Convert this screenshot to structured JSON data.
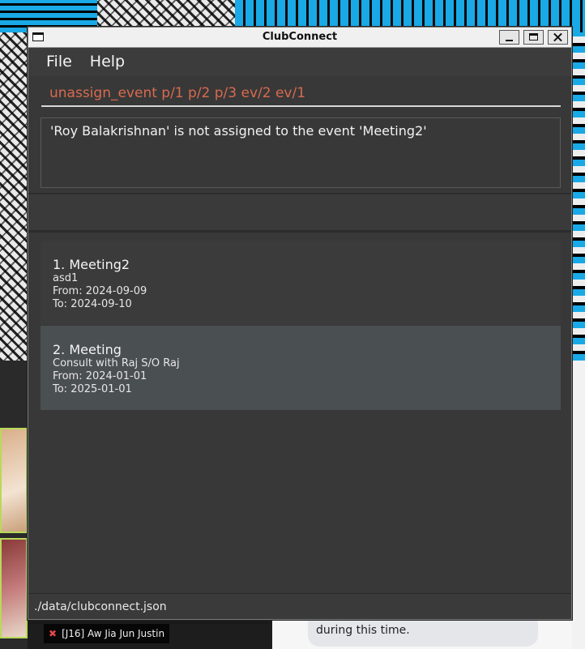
{
  "window": {
    "title": "ClubConnect"
  },
  "menu": {
    "items": [
      "File",
      "Help"
    ]
  },
  "command": {
    "value": "unassign_event p/1 p/2 p/3 ev/2 ev/1"
  },
  "result": {
    "message": "'Roy Balakrishnan' is not assigned to the event 'Meeting2'"
  },
  "events": [
    {
      "title": "1. Meeting2",
      "description": "asd1",
      "from": "From: 2024-09-09",
      "to": "To: 2024-09-10"
    },
    {
      "title": "2. Meeting",
      "description": "Consult with Raj S/O Raj",
      "from": "From: 2024-01-01",
      "to": "To: 2025-01-01"
    }
  ],
  "status": {
    "path": "./data/clubconnect.json"
  },
  "background": {
    "caption": "[J16] Aw Jia Jun Justin",
    "chat_text": "during this time."
  },
  "colors": {
    "command_text": "#d96a4e",
    "window_bg": "#383838",
    "selected_card": "#4a4f52"
  }
}
